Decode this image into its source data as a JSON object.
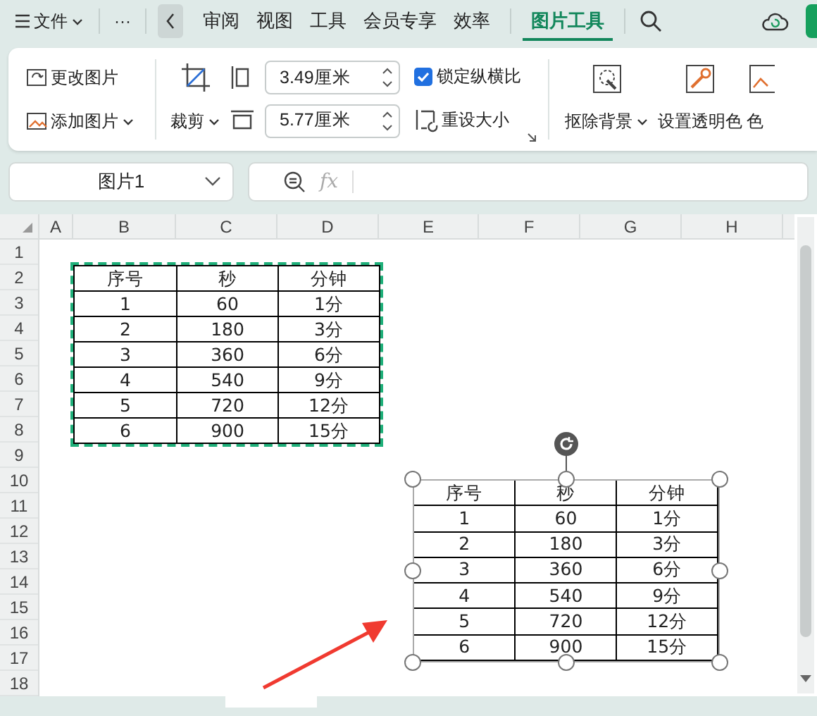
{
  "top_bar": {
    "file_menu": "文件",
    "more": "···",
    "tabs": [
      {
        "label": "审阅",
        "selected": false
      },
      {
        "label": "视图",
        "selected": false
      },
      {
        "label": "工具",
        "selected": false
      },
      {
        "label": "会员专享",
        "selected": false
      },
      {
        "label": "效率",
        "selected": false
      },
      {
        "label": "图片工具",
        "selected": true
      }
    ]
  },
  "ribbon": {
    "change_picture": "更改图片",
    "add_picture": "添加图片",
    "crop": "裁剪",
    "height": "3.49厘米",
    "width": "5.77厘米",
    "lock_aspect": {
      "label": "锁定纵横比",
      "checked": true
    },
    "reset_size": "重设大小",
    "remove_background": "抠除背景",
    "set_transparent": "设置透明色",
    "color_button": "色"
  },
  "name_box": "图片1",
  "formula_bar": {
    "fx": "fx"
  },
  "sheet": {
    "columns": [
      "A",
      "B",
      "C",
      "D",
      "E",
      "F",
      "G",
      "H"
    ],
    "rows": [
      "1",
      "2",
      "3",
      "4",
      "5",
      "6",
      "7",
      "8",
      "9",
      "10",
      "11",
      "12",
      "13",
      "14",
      "15",
      "16",
      "17",
      "18"
    ],
    "data_table": {
      "header": [
        "序号",
        "秒",
        "分钟"
      ],
      "rows": [
        [
          "1",
          "60",
          "1分"
        ],
        [
          "2",
          "180",
          "3分"
        ],
        [
          "3",
          "360",
          "6分"
        ],
        [
          "4",
          "540",
          "9分"
        ],
        [
          "5",
          "720",
          "12分"
        ],
        [
          "6",
          "900",
          "15分"
        ]
      ]
    },
    "picture": {
      "selected": true,
      "header": [
        "序号",
        "秒",
        "分钟"
      ],
      "rows": [
        [
          "1",
          "60",
          "1分"
        ],
        [
          "2",
          "180",
          "3分"
        ],
        [
          "3",
          "360",
          "6分"
        ],
        [
          "4",
          "540",
          "9分"
        ],
        [
          "5",
          "720",
          "12分"
        ],
        [
          "6",
          "900",
          "15分"
        ]
      ]
    }
  }
}
